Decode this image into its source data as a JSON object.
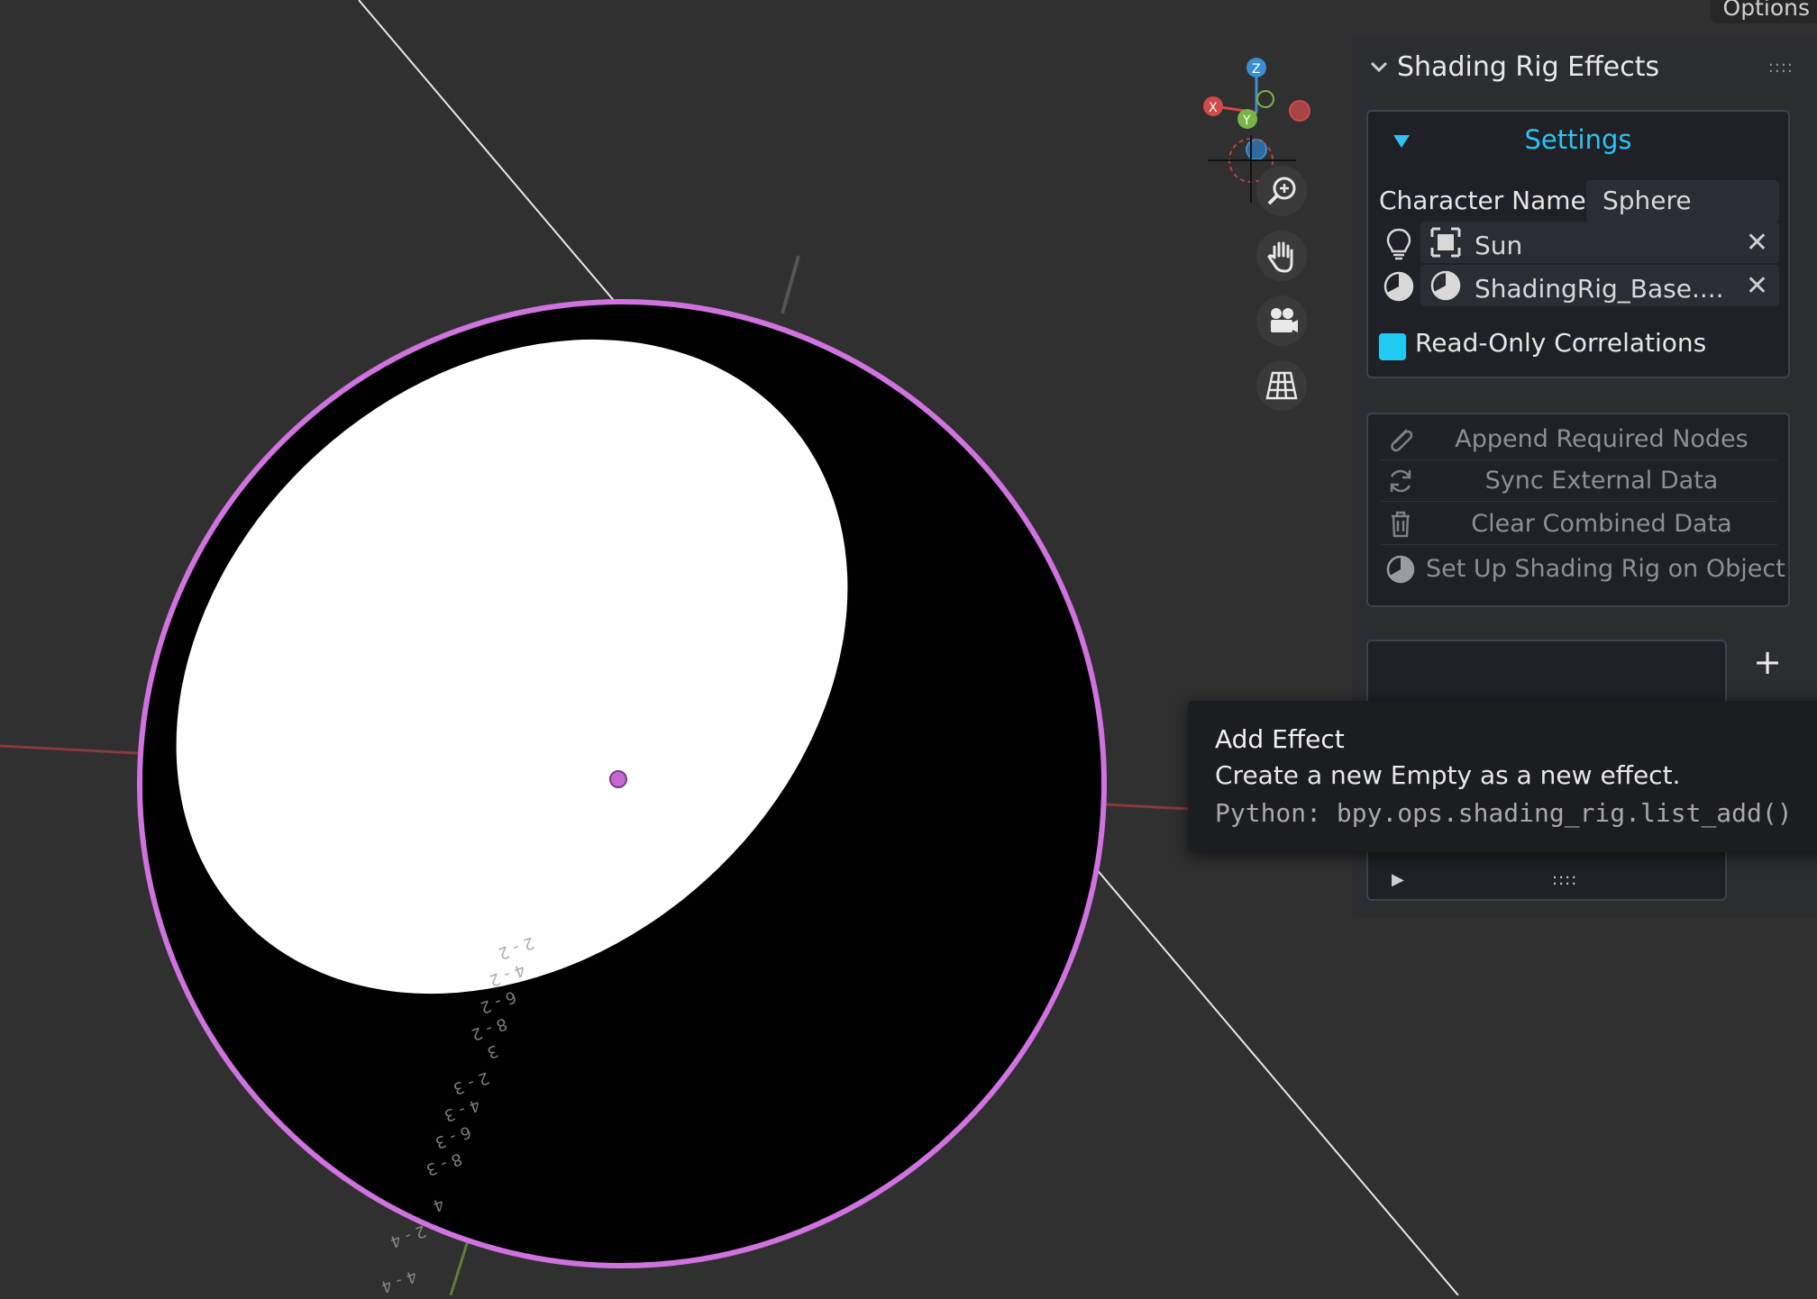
{
  "header": {
    "options_label": "Options"
  },
  "viewport": {
    "gizmo_axes": {
      "x": "X",
      "y": "Y",
      "z": "Z"
    },
    "grid_numbers": [
      "2-2",
      "4-2",
      "6-2",
      "8-2",
      "3",
      "2-3",
      "4-3",
      "6-3",
      "8-3",
      "4",
      "2-4",
      "4-4"
    ],
    "icons": [
      "zoom-icon",
      "hand-icon",
      "camera-icon",
      "grid-icon"
    ]
  },
  "panel": {
    "title": "Shading Rig Effects",
    "grip": "::::",
    "settings": {
      "title": "Settings",
      "character_name_label": "Character Name",
      "character_name_value": "Sphere",
      "light_field": "Sun",
      "material_field": "ShadingRig_Base....",
      "clear_glyph": "✕",
      "read_only_label": "Read-Only Correlations"
    },
    "operators": [
      {
        "label": "Append Required Nodes",
        "icon": "paperclip-icon"
      },
      {
        "label": "Sync External Data",
        "icon": "refresh-icon"
      },
      {
        "label": "Clear Combined Data",
        "icon": "trash-icon"
      },
      {
        "label": "Set Up Shading Rig on Object",
        "icon": "shading-icon"
      }
    ],
    "list": {
      "add_glyph": "+",
      "play_glyph": "▶",
      "grip_glyph": "::::"
    }
  },
  "tooltip": {
    "title": "Add Effect",
    "description": "Create a new Empty as a new effect.",
    "python": "Python: bpy.ops.shading_rig.list_add()"
  },
  "colors": {
    "background": "#303030",
    "accent": "#1fcbf2",
    "selection_outline": "#d072e0",
    "panel": "#2b2d31"
  }
}
